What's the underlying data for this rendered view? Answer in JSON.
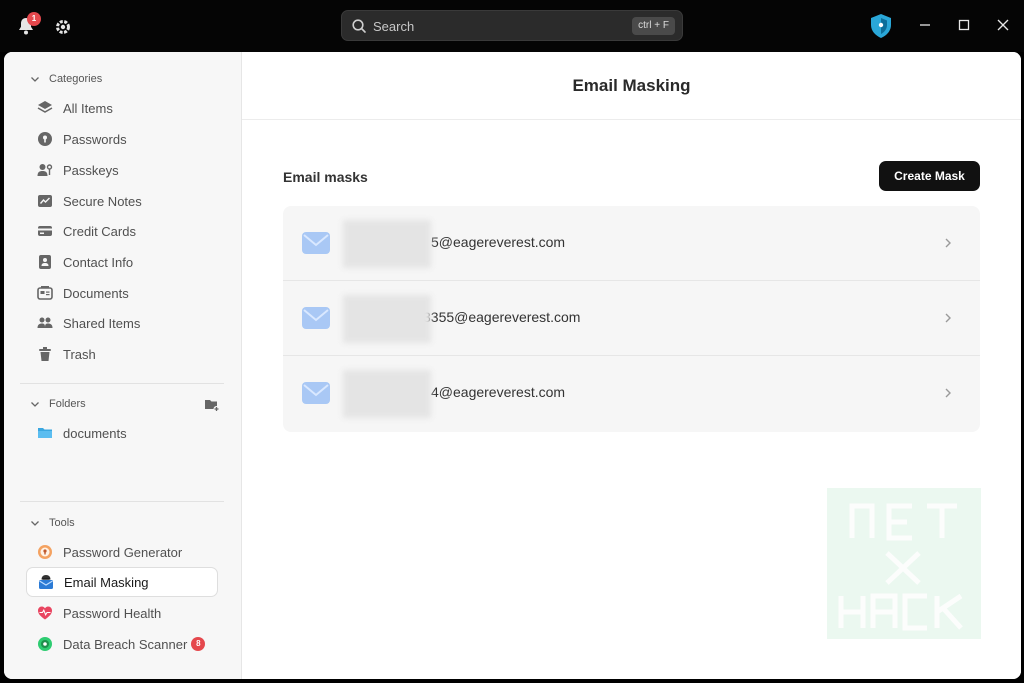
{
  "titlebar": {
    "notification_count": "1",
    "search_placeholder": "Search",
    "search_shortcut": "ctrl + F"
  },
  "sidebar": {
    "categories_label": "Categories",
    "categories": [
      {
        "label": "All Items",
        "icon": "layers-icon"
      },
      {
        "label": "Passwords",
        "icon": "key-icon"
      },
      {
        "label": "Passkeys",
        "icon": "passkey-icon"
      },
      {
        "label": "Secure Notes",
        "icon": "note-icon"
      },
      {
        "label": "Credit Cards",
        "icon": "credit-card-icon"
      },
      {
        "label": "Contact Info",
        "icon": "contact-icon"
      },
      {
        "label": "Documents",
        "icon": "document-icon"
      },
      {
        "label": "Shared Items",
        "icon": "users-icon"
      },
      {
        "label": "Trash",
        "icon": "trash-icon"
      }
    ],
    "folders_label": "Folders",
    "folders": [
      {
        "label": "documents",
        "icon": "folder-icon"
      }
    ],
    "tools_label": "Tools",
    "tools": [
      {
        "label": "Password Generator",
        "icon": "password-generator-icon"
      },
      {
        "label": "Email Masking",
        "icon": "email-masking-icon",
        "active": true
      },
      {
        "label": "Password Health",
        "icon": "heart-icon"
      },
      {
        "label": "Data Breach Scanner",
        "icon": "scanner-icon",
        "badge": "8"
      }
    ]
  },
  "main": {
    "title": "Email Masking",
    "section_heading": "Email masks",
    "create_button": "Create Mask",
    "masks": [
      {
        "email": "5@eagereverest.com"
      },
      {
        "email": "3355@eagereverest.com"
      },
      {
        "email": "4@eagereverest.com"
      }
    ]
  },
  "colors": {
    "accent": "#111111",
    "badge": "#e5484d",
    "mail_icon": "#a9c8f5"
  }
}
